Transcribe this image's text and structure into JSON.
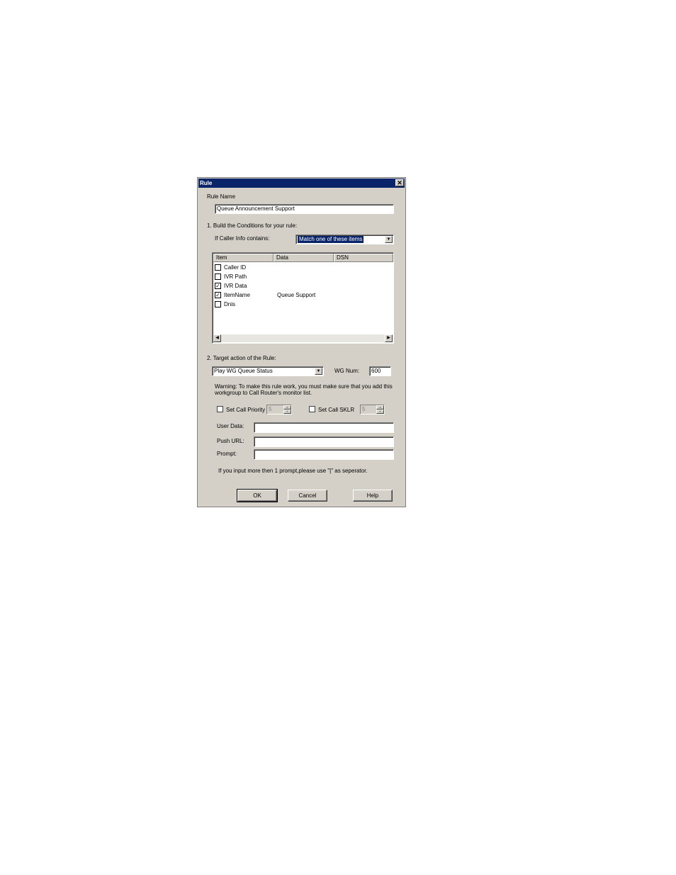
{
  "dialog": {
    "title": "Rule",
    "close_glyph": "✕"
  },
  "rule_name": {
    "label": "Rule Name",
    "value": "Queue Announcement Support"
  },
  "conditions": {
    "heading": "1. Build the Conditions for your rule:",
    "caller_info_label": "If Caller Info contains:",
    "match_selected": "Match one of these items",
    "columns": [
      "Item",
      "Data",
      "DSN"
    ],
    "items": [
      {
        "name": "Caller ID",
        "data": "",
        "checked": false
      },
      {
        "name": "IVR Path",
        "data": "",
        "checked": false
      },
      {
        "name": "IVR Data",
        "data": "",
        "checked": true
      },
      {
        "name": "ItemName",
        "data": "Queue Support",
        "checked": true
      },
      {
        "name": "Dnis",
        "data": "",
        "checked": false
      }
    ]
  },
  "target": {
    "heading": "2. Target action of the Rule:",
    "action_selected": "Play WG Queue Status",
    "wg_num_label": "WG Num:",
    "wg_num_value": "600",
    "warning_line1": "Warning: To make this rule work, you must make sure that you add this",
    "warning_line2": "workgroup to Call Router's monitor list.",
    "set_call_priority_label": "Set Call Priority",
    "call_priority_value": "5",
    "set_call_sklr_label": "Set Call SKLR",
    "call_sklr_value": "5",
    "user_data_label": "User Data:",
    "user_data_value": "",
    "push_url_label": "Push URL:",
    "push_url_value": "",
    "prompt_label": "Prompt:",
    "prompt_value": "",
    "prompt_note": "If you input more then 1 prompt,please use \"|\" as seperator."
  },
  "buttons": {
    "ok": "OK",
    "cancel": "Cancel",
    "help": "Help"
  },
  "icons": {
    "dropdown": "chevron-down-icon",
    "check": "checkmark-icon",
    "scroll_left": "arrow-left-icon",
    "scroll_right": "arrow-right-icon"
  }
}
